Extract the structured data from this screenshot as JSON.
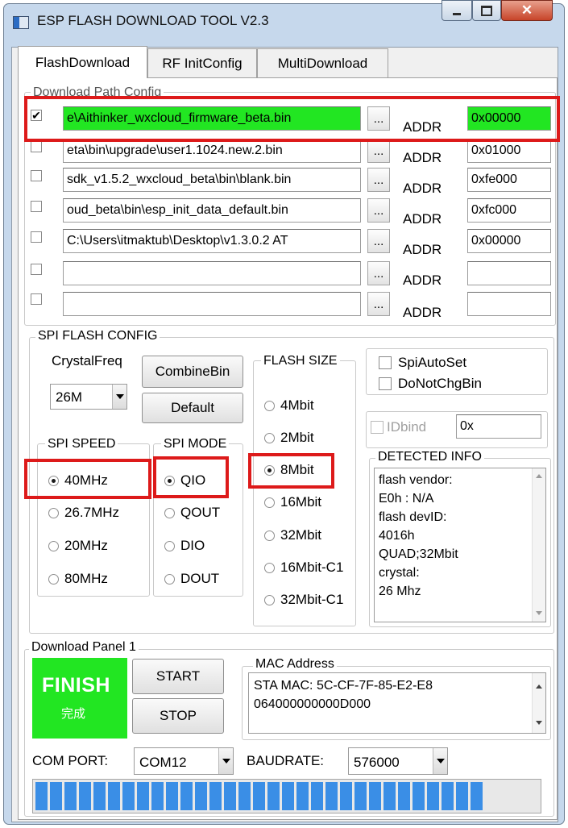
{
  "window": {
    "title": "ESP FLASH DOWNLOAD TOOL V2.3"
  },
  "tabs": [
    {
      "label": "FlashDownload"
    },
    {
      "label": "RF InitConfig"
    },
    {
      "label": "MultiDownload"
    }
  ],
  "download_path": {
    "title": "Download Path Config",
    "browse_label": "...",
    "addr_label": "ADDR",
    "rows": [
      {
        "checked": true,
        "path": "e\\Aithinker_wxcloud_firmware_beta.bin",
        "addr": "0x00000",
        "checkmark": "✔"
      },
      {
        "checked": false,
        "path": "eta\\bin\\upgrade\\user1.1024.new.2.bin",
        "addr": "0x01000"
      },
      {
        "checked": false,
        "path": "sdk_v1.5.2_wxcloud_beta\\bin\\blank.bin",
        "addr": "0xfe000"
      },
      {
        "checked": false,
        "path": "oud_beta\\bin\\esp_init_data_default.bin",
        "addr": "0xfc000"
      },
      {
        "checked": false,
        "path": "C:\\Users\\itmaktub\\Desktop\\v1.3.0.2 AT",
        "addr": "0x00000"
      },
      {
        "checked": false,
        "path": "",
        "addr": ""
      },
      {
        "checked": false,
        "path": "",
        "addr": ""
      }
    ]
  },
  "spi_config": {
    "title": "SPI FLASH CONFIG",
    "crystal_label": "CrystalFreq",
    "crystal_value": "26M",
    "combine_label": "CombineBin",
    "default_label": "Default",
    "flash_size_title": "FLASH SIZE",
    "flash_sizes": [
      "4Mbit",
      "2Mbit",
      "8Mbit",
      "16Mbit",
      "32Mbit",
      "16Mbit-C1",
      "32Mbit-C1"
    ],
    "flash_size_selected": "8Mbit",
    "spi_speed_title": "SPI SPEED",
    "spi_speeds": [
      "40MHz",
      "26.7MHz",
      "20MHz",
      "80MHz"
    ],
    "spi_speed_selected": "40MHz",
    "spi_mode_title": "SPI MODE",
    "spi_modes": [
      "QIO",
      "QOUT",
      "DIO",
      "DOUT"
    ],
    "spi_mode_selected": "QIO",
    "spi_auto_set": "SpiAutoSet",
    "do_not_chg_bin": "DoNotChgBin",
    "idbind_label": "IDbind",
    "idbind_value": "0x",
    "detected_title": "DETECTED INFO",
    "detected_lines": [
      "flash vendor:",
      "E0h : N/A",
      "flash devID:",
      "4016h",
      "QUAD;32Mbit",
      "crystal:",
      "26 Mhz"
    ]
  },
  "download_panel": {
    "title": "Download Panel 1",
    "status": "FINISH",
    "status_cn": "完成",
    "status_color": "#22e622",
    "start_label": "START",
    "stop_label": "STOP",
    "mac_title": "MAC Address",
    "mac_lines": [
      "STA MAC:  5C-CF-7F-85-E2-E8",
      "064000000000D000"
    ],
    "com_label": "COM PORT:",
    "com_value": "COM12",
    "baud_label": "BAUDRATE:",
    "baud_value": "576000",
    "progress_segments": 31,
    "progress_percent": 100
  },
  "colors": {
    "accent_green": "#22e622",
    "highlight_red": "#dd1a1a",
    "progress_blue": "#3a8ee6"
  }
}
